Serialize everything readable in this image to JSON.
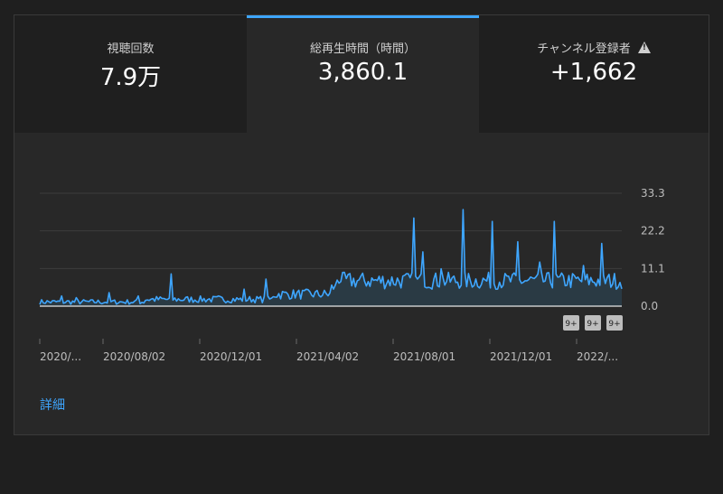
{
  "tabs": [
    {
      "label": "視聴回数",
      "value": "7.9万",
      "warning": false,
      "active": false
    },
    {
      "label": "総再生時間（時間）",
      "value": "3,860.1",
      "warning": false,
      "active": true
    },
    {
      "label": "チャンネル登録者",
      "value": "+1,662",
      "warning": true,
      "active": false
    }
  ],
  "chart_data": {
    "type": "area",
    "y_ticks": [
      "33.3",
      "22.2",
      "11.1",
      "0.0"
    ],
    "ylim": [
      0,
      33.3
    ],
    "x_ticks": [
      "2020/...",
      "2020/08/02",
      "2020/12/01",
      "2021/04/02",
      "2021/08/01",
      "2021/12/01",
      "2022/..."
    ],
    "markers": [
      "9+",
      "9+",
      "9+"
    ],
    "series_color": "#3ea6ff",
    "grid": true
  },
  "details_link": "詳細"
}
